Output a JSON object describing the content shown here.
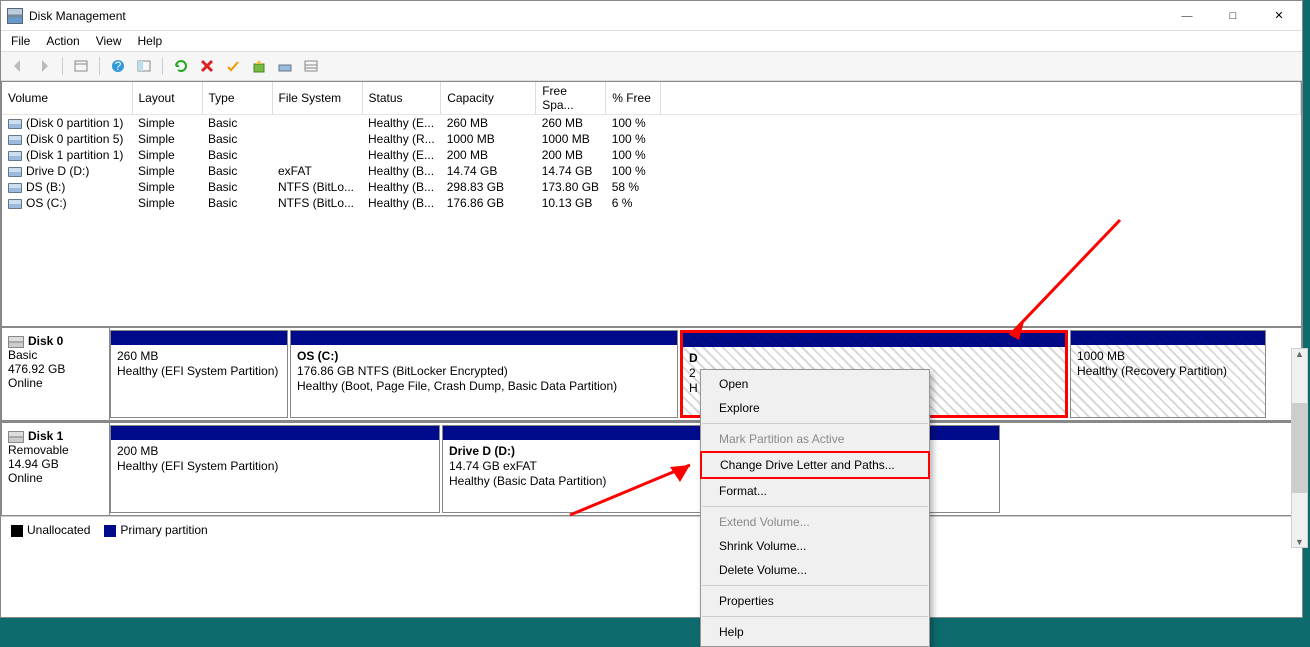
{
  "window": {
    "title": "Disk Management"
  },
  "menu": {
    "file": "File",
    "action": "Action",
    "view": "View",
    "help": "Help"
  },
  "columns": {
    "volume": "Volume",
    "layout": "Layout",
    "type": "Type",
    "fs": "File System",
    "status": "Status",
    "capacity": "Capacity",
    "free": "Free Spa...",
    "pfree": "% Free"
  },
  "volumes": [
    {
      "name": "(Disk 0 partition 1)",
      "layout": "Simple",
      "type": "Basic",
      "fs": "",
      "status": "Healthy (E...",
      "capacity": "260 MB",
      "free": "260 MB",
      "pfree": "100 %"
    },
    {
      "name": "(Disk 0 partition 5)",
      "layout": "Simple",
      "type": "Basic",
      "fs": "",
      "status": "Healthy (R...",
      "capacity": "1000 MB",
      "free": "1000 MB",
      "pfree": "100 %"
    },
    {
      "name": "(Disk 1 partition 1)",
      "layout": "Simple",
      "type": "Basic",
      "fs": "",
      "status": "Healthy (E...",
      "capacity": "200 MB",
      "free": "200 MB",
      "pfree": "100 %"
    },
    {
      "name": "Drive D (D:)",
      "layout": "Simple",
      "type": "Basic",
      "fs": "exFAT",
      "status": "Healthy (B...",
      "capacity": "14.74 GB",
      "free": "14.74 GB",
      "pfree": "100 %"
    },
    {
      "name": "DS (B:)",
      "layout": "Simple",
      "type": "Basic",
      "fs": "NTFS (BitLo...",
      "status": "Healthy (B...",
      "capacity": "298.83 GB",
      "free": "173.80 GB",
      "pfree": "58 %"
    },
    {
      "name": "OS (C:)",
      "layout": "Simple",
      "type": "Basic",
      "fs": "NTFS (BitLo...",
      "status": "Healthy (B...",
      "capacity": "176.86 GB",
      "free": "10.13 GB",
      "pfree": "6 %"
    }
  ],
  "disk0": {
    "head": {
      "name": "Disk 0",
      "type": "Basic",
      "size": "476.92 GB",
      "state": "Online"
    },
    "p1": {
      "l1": "260 MB",
      "l2": "Healthy (EFI System Partition)"
    },
    "p2": {
      "title": "OS  (C:)",
      "l1": "176.86 GB NTFS (BitLocker Encrypted)",
      "l2": "Healthy (Boot, Page File, Crash Dump, Basic Data Partition)"
    },
    "p3": {
      "title": "D",
      "l1": "2",
      "l2": "H"
    },
    "p4": {
      "l1": "1000 MB",
      "l2": "Healthy (Recovery Partition)"
    }
  },
  "disk1": {
    "head": {
      "name": "Disk 1",
      "type": "Removable",
      "size": "14.94 GB",
      "state": "Online"
    },
    "p1": {
      "l1": "200 MB",
      "l2": "Healthy (EFI System Partition)"
    },
    "p2": {
      "title": "Drive D  (D:)",
      "l1": "14.74 GB exFAT",
      "l2": "Healthy (Basic Data Partition)"
    }
  },
  "legend": {
    "unalloc": "Unallocated",
    "primary": "Primary partition"
  },
  "ctx": {
    "open": "Open",
    "explore": "Explore",
    "mark": "Mark Partition as Active",
    "change": "Change Drive Letter and Paths...",
    "format": "Format...",
    "extend": "Extend Volume...",
    "shrink": "Shrink Volume...",
    "delete": "Delete Volume...",
    "props": "Properties",
    "help": "Help"
  }
}
